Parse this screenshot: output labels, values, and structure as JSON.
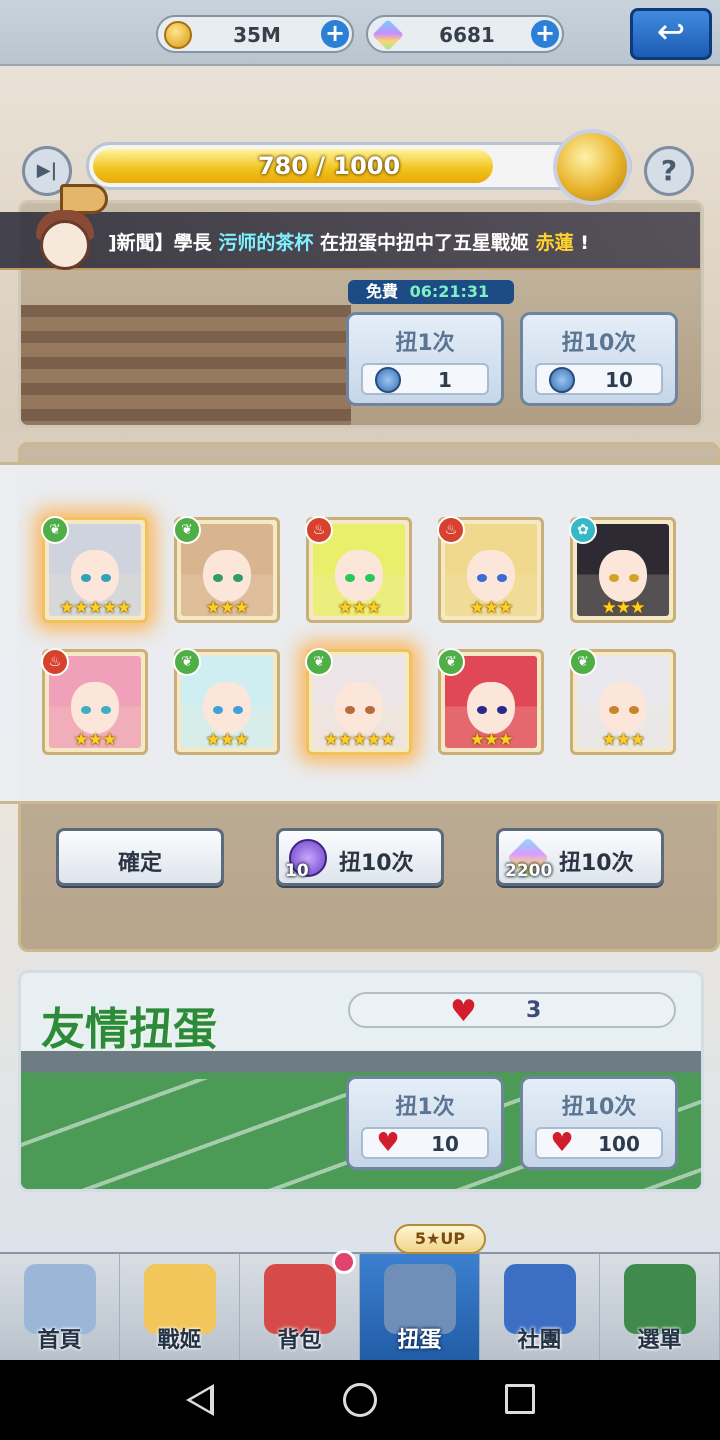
{
  "currencies": {
    "gold": {
      "value": "35M",
      "icon": "gold-coin-icon"
    },
    "gems": {
      "value": "6681",
      "icon": "rainbow-gem-icon"
    }
  },
  "pity": {
    "text": "780 / 1000",
    "current": 780,
    "max": 1000
  },
  "news": {
    "prefix": "]新聞】學長",
    "user": "污师的茶杯",
    "middle": "在扭蛋中扭中了五星戰姬",
    "hero": "赤蓮",
    "suffix": "!"
  },
  "premium_gacha": {
    "free_label": "免費",
    "free_timer": "06:21:31",
    "pull1": {
      "label": "扭1次",
      "cost": "1"
    },
    "pull10": {
      "label": "扭10次",
      "cost": "10"
    }
  },
  "results": [
    {
      "element": "leaf",
      "rarity": 5,
      "hair": "#cfd3de",
      "eyes": "#2fa4b8"
    },
    {
      "element": "leaf",
      "rarity": 3,
      "hair": "#d8b48f",
      "eyes": "#2f9e6b"
    },
    {
      "element": "fire",
      "rarity": 3,
      "hair": "#e9ef6a",
      "eyes": "#27c85a"
    },
    {
      "element": "fire",
      "rarity": 3,
      "hair": "#f0d88c",
      "eyes": "#3b6bd6"
    },
    {
      "element": "water",
      "rarity": 3,
      "hair": "#2d2a34",
      "eyes": "#d8a02a"
    },
    {
      "element": "fire",
      "rarity": 3,
      "hair": "#f0a0b8",
      "eyes": "#3bb0c0"
    },
    {
      "element": "leaf",
      "rarity": 3,
      "hair": "#cfeef2",
      "eyes": "#3fa3d8"
    },
    {
      "element": "leaf",
      "rarity": 5,
      "hair": "#ece4e6",
      "eyes": "#b56b3a"
    },
    {
      "element": "leaf",
      "rarity": 3,
      "hair": "#e04858",
      "eyes": "#2a2a8a"
    },
    {
      "element": "leaf",
      "rarity": 3,
      "hair": "#e8e8ee",
      "eyes": "#c8842a"
    }
  ],
  "actions": {
    "confirm": "確定",
    "pull10_ticket": {
      "label": "扭10次",
      "count": "10"
    },
    "pull10_gem": {
      "label": "扭10次",
      "count": "2200"
    }
  },
  "friend_gacha": {
    "title": "友情扭蛋",
    "hearts": "3",
    "pull1": {
      "label": "扭1次",
      "cost": "10"
    },
    "pull10": {
      "label": "扭10次",
      "cost": "100"
    }
  },
  "up_badge": "5★UP",
  "nav": [
    {
      "label": "首頁",
      "color": "#9ab7d8"
    },
    {
      "label": "戰姬",
      "color": "#f2c65a"
    },
    {
      "label": "背包",
      "color": "#d64a4a"
    },
    {
      "label": "扭蛋",
      "color": "#6f8fb8"
    },
    {
      "label": "社團",
      "color": "#3c6fc4"
    },
    {
      "label": "選單",
      "color": "#3f8a4c"
    }
  ],
  "colors": {
    "accent": "#2b7fd6",
    "gold": "#f2c21a",
    "fiveStarGlow": "#ffaa3c"
  }
}
